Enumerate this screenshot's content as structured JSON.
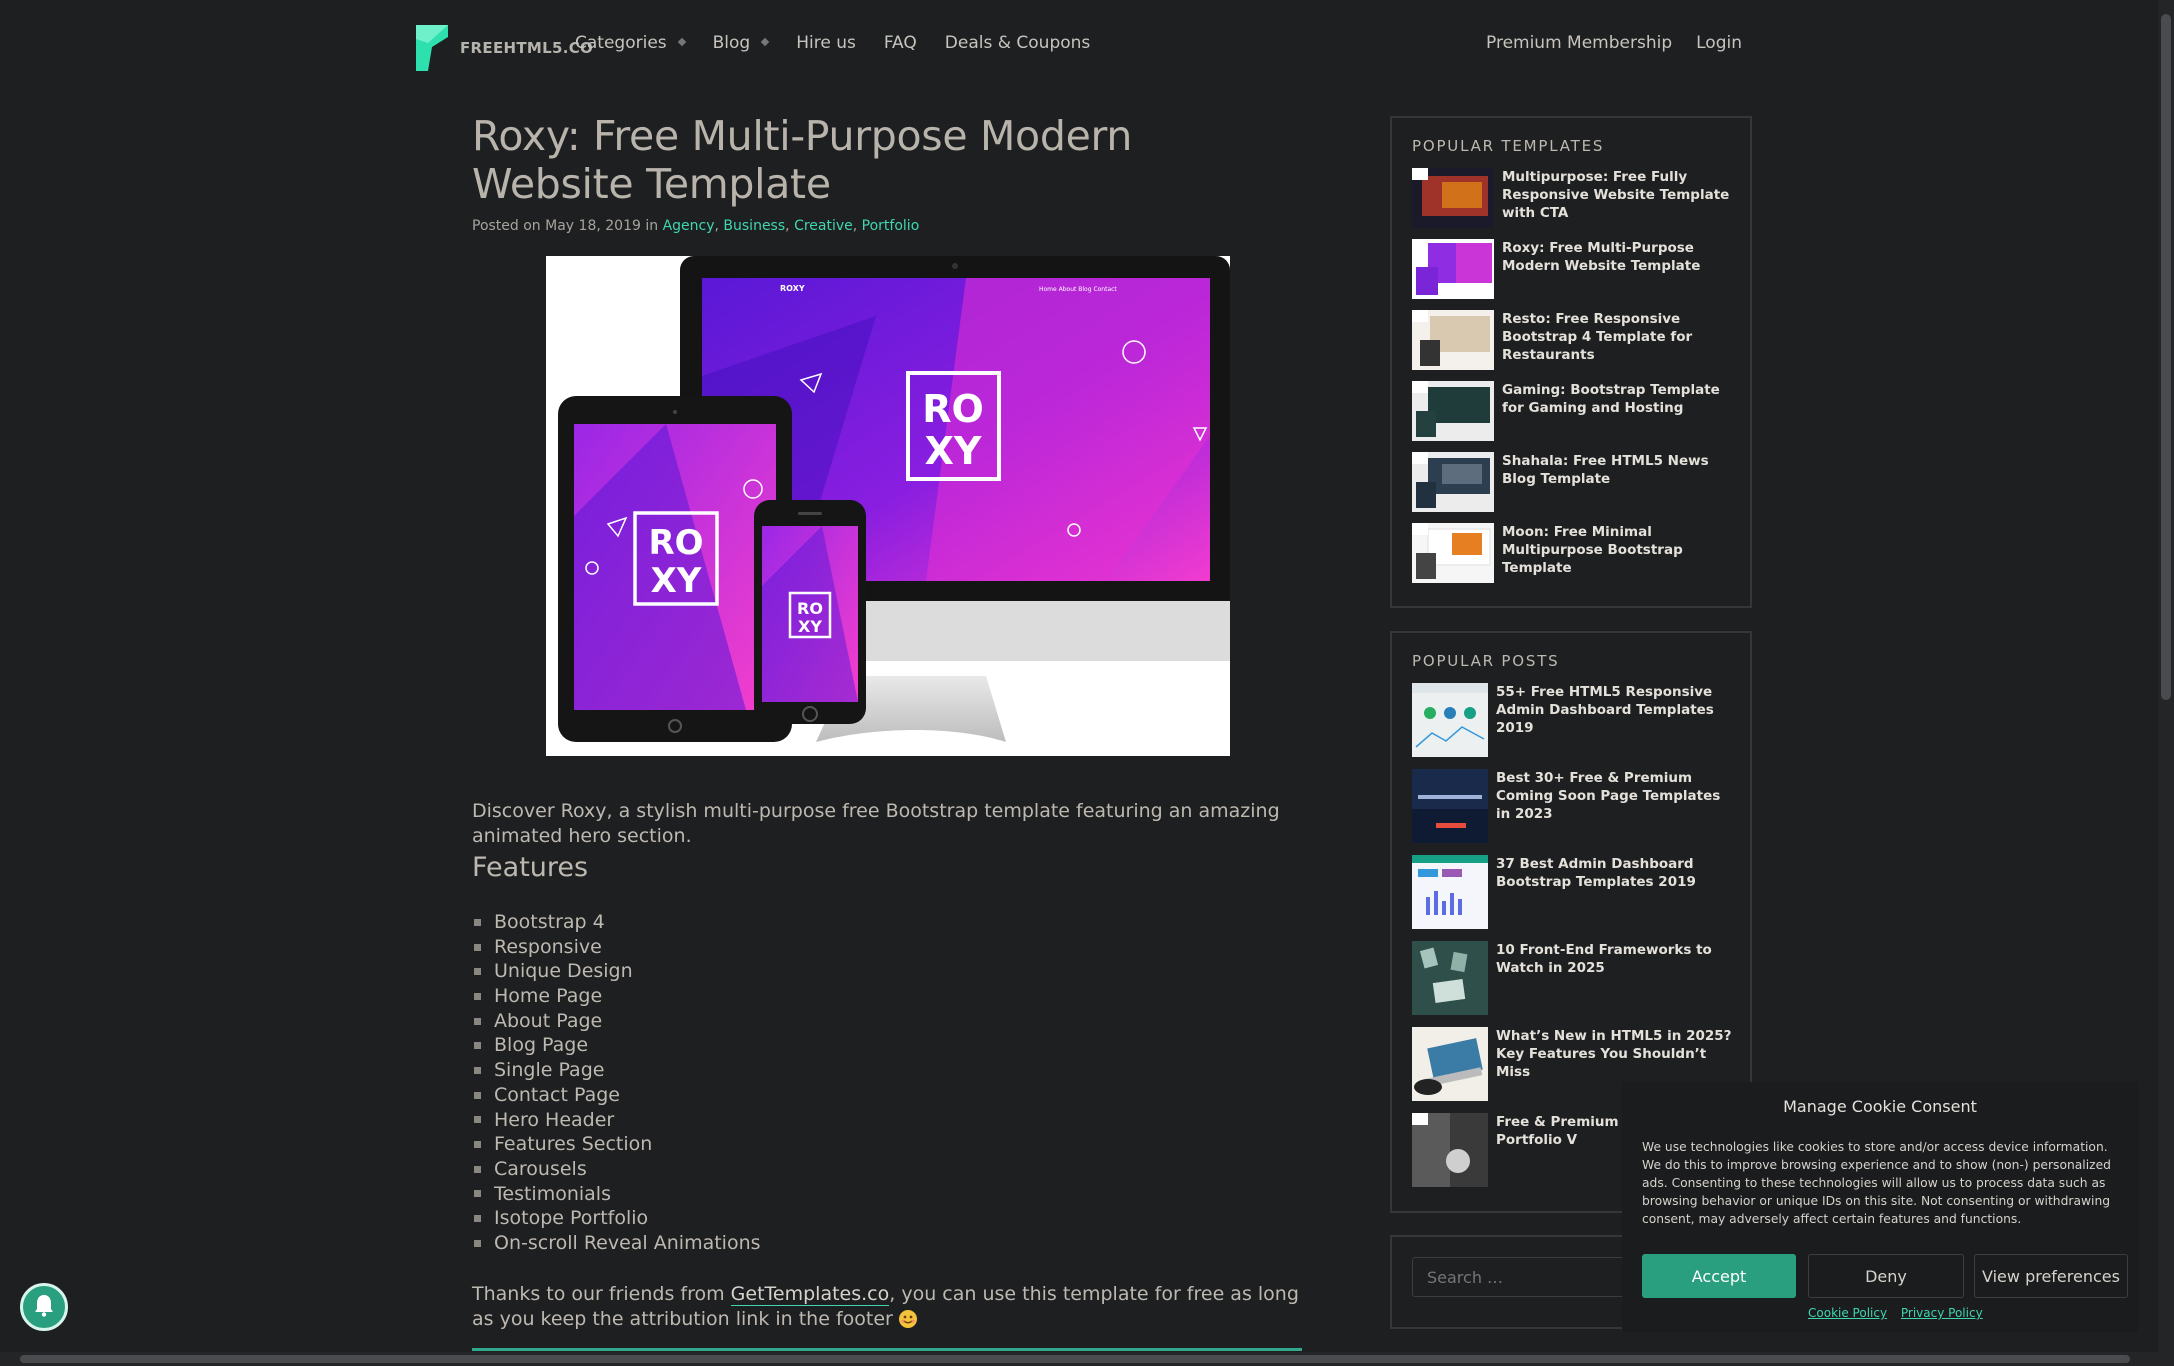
{
  "nav": {
    "logo_text": "FREEHTML5.CO",
    "left": [
      {
        "label": "Categories",
        "dropdown": true
      },
      {
        "label": "Blog",
        "dropdown": true
      },
      {
        "label": "Hire us",
        "dropdown": false
      },
      {
        "label": "FAQ",
        "dropdown": false
      },
      {
        "label": "Deals & Coupons",
        "dropdown": false
      }
    ],
    "right": [
      {
        "label": "Premium Membership"
      },
      {
        "label": "Login"
      }
    ]
  },
  "article": {
    "title": "Roxy: Free Multi-Purpose Modern Website Template",
    "posted_prefix": "Posted on",
    "date": "May 18, 2019",
    "in_word": "in",
    "categories": [
      "Agency",
      "Business",
      "Creative",
      "Portfolio"
    ],
    "hero_brand": "ROXY",
    "hero_logo_line1": "RO",
    "hero_logo_line2": "XY",
    "hero_nav": "Home   About   Blog   Contact",
    "intro": "Discover Roxy, a stylish multi-purpose free Bootstrap template featuring an amazing animated hero section.",
    "features_heading": "Features",
    "features": [
      "Bootstrap 4",
      "Responsive",
      "Unique Design",
      "Home Page",
      "About Page",
      "Blog Page",
      "Single Page",
      "Contact Page",
      "Hero Header",
      "Features Section",
      "Carousels",
      "Testimonials",
      "Isotope Portfolio",
      "On-scroll Reveal Animations"
    ],
    "thanks_before": "Thanks to our friends from ",
    "thanks_link": "GetTemplates.co",
    "thanks_after": ", you can use this template for free as long as you keep the attribution link in the footer"
  },
  "sidebar": {
    "popular_templates_title": "POPULAR TEMPLATES",
    "popular_templates": [
      {
        "title": "Multipurpose: Free Fully Responsive Website Template with CTA",
        "accent": "#c0392b"
      },
      {
        "title": "Roxy: Free Multi-Purpose Modern Website Template",
        "accent": "#8e2de2"
      },
      {
        "title": "Resto: Free Responsive Bootstrap 4 Template for Restaurants",
        "accent": "#d8c9b0"
      },
      {
        "title": "Gaming: Bootstrap Template for Gaming and Hosting",
        "accent": "#1f3b3a"
      },
      {
        "title": "Shahala: Free HTML5 News Blog Template",
        "accent": "#2c3e50"
      },
      {
        "title": "Moon: Free Minimal Multipurpose Bootstrap Template",
        "accent": "#e67e22"
      }
    ],
    "popular_posts_title": "POPULAR POSTS",
    "popular_posts": [
      {
        "title": "55+ Free HTML5 Responsive Admin Dashboard Templates 2019",
        "accent": "#ecf0f1"
      },
      {
        "title": "Best 30+ Free & Premium Coming Soon Page Templates in 2023",
        "accent": "#1a2a4a"
      },
      {
        "title": "37 Best Admin Dashboard Bootstrap Templates 2019",
        "accent": "#f4f6fb"
      },
      {
        "title": "10 Front-End Frameworks to Watch in 2025",
        "accent": "#2f4f4a"
      },
      {
        "title": "What’s New in HTML5 in 2025? Key Features You Shouldn’t Miss",
        "accent": "#f2efe9"
      },
      {
        "title": "Free & Premium Ph Creative Portfolio V",
        "accent": "#3a3a3a"
      }
    ],
    "search_placeholder": "Search …"
  },
  "cookie": {
    "title": "Manage Cookie Consent",
    "text": "We use technologies like cookies to store and/or access device information. We do this to improve browsing experience and to show (non-) personalized ads. Consenting to these technologies will allow us to process data such as browsing behavior or unique IDs on this site. Not consenting or withdrawing consent, may adversely affect certain features and functions.",
    "accept": "Accept",
    "deny": "Deny",
    "preferences": "View preferences",
    "cookie_policy": "Cookie Policy",
    "privacy_policy": "Privacy Policy"
  },
  "colors": {
    "background": "#1e1f21",
    "accent": "#3fd6b0",
    "button": "#2a9f7f",
    "hero_gradient_start": "#6a1fd8",
    "hero_gradient_end": "#f23bd0"
  }
}
